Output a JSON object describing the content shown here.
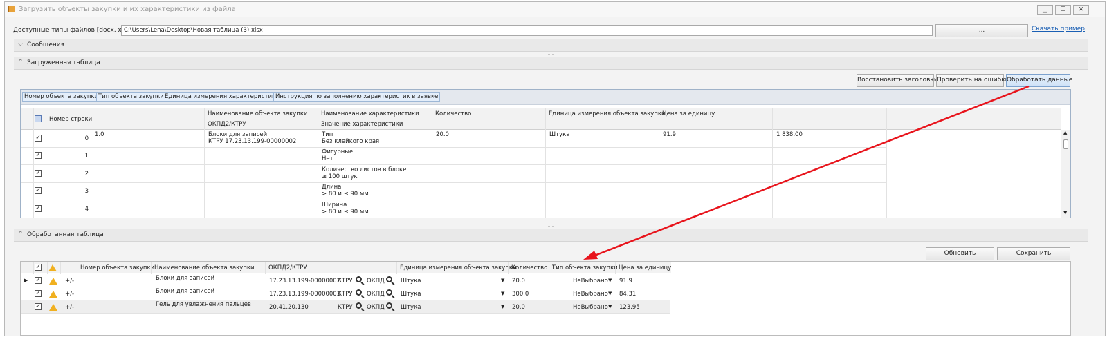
{
  "window": {
    "title": "Загрузить объекты закупки и их характеристики из файла",
    "min": "▁",
    "max": "☐",
    "close": "✕"
  },
  "file": {
    "label": "Доступные типы файлов [docx, xlsx]",
    "path": "C:\\Users\\Lena\\Desktop\\Новая таблица (3).xlsx",
    "browse": "...",
    "sample_link": "Скачать пример"
  },
  "sections": {
    "messages": "Сообщения",
    "loaded": "Загруженная таблица",
    "processed": "Обработанная таблица"
  },
  "loaded_buttons": {
    "restore": "Восстановить заголовки",
    "check": "Проверить на ошибки",
    "process": "Обработать данные"
  },
  "group_chips": [
    "Номер объекта закупки",
    "Тип объекта закупки",
    "Единица измерения характеристики",
    "Инструкция по заполнению характеристик в заявке"
  ],
  "loaded_headers": {
    "row_no": "Номер строки",
    "name1": "Наименование объекта закупки",
    "name2": "ОКПД2/КТРУ",
    "char1": "Наименование характеристики",
    "char2": "Значение характеристики",
    "qty": "Количество",
    "unit": "Единица измерения объекта закупки",
    "price": "Цена за единицу"
  },
  "loaded_rows": [
    {
      "checked": true,
      "row": "0",
      "num": "1.0",
      "name1": "Блоки для записей",
      "name2": "КТРУ 17.23.13.199-00000002",
      "char1": "Тип",
      "char2": "Без клейкого края",
      "qty": "20.0",
      "unit": "Штука",
      "price": "91.9",
      "total": "1 838,00"
    },
    {
      "checked": true,
      "row": "1",
      "num": "",
      "name1": "",
      "name2": "",
      "char1": "Фигурные",
      "char2": "Нет",
      "qty": "",
      "unit": "",
      "price": "",
      "total": ""
    },
    {
      "checked": true,
      "row": "2",
      "num": "",
      "name1": "",
      "name2": "",
      "char1": "Количество листов в блоке",
      "char2": "≥ 100 штук",
      "qty": "",
      "unit": "",
      "price": "",
      "total": ""
    },
    {
      "checked": true,
      "row": "3",
      "num": "",
      "name1": "",
      "name2": "",
      "char1": "Длина",
      "char2": "> 80 и ≤ 90 мм",
      "qty": "",
      "unit": "",
      "price": "",
      "total": ""
    },
    {
      "checked": true,
      "row": "4",
      "num": "",
      "name1": "",
      "name2": "",
      "char1": "Ширина",
      "char2": "> 80 и ≤ 90 мм",
      "qty": "",
      "unit": "",
      "price": "",
      "total": ""
    }
  ],
  "processed_buttons": {
    "refresh": "Обновить",
    "save": "Сохранить"
  },
  "processed_headers": {
    "num": "Номер объекта закупки",
    "name": "Наименование объекта закупки",
    "okpd": "ОКПД2/КТРУ",
    "unit": "Единица измерения объекта закупки",
    "qty": "Количество",
    "type": "Тип объекта закупки",
    "price": "Цена за единицу"
  },
  "processed_rows": [
    {
      "pm": "+/-",
      "name": "Блоки для записей",
      "okpd": "17.23.13.199-00000002",
      "ktru": "КТРУ",
      "okpd_btn": "ОКПД",
      "unit": "Штука",
      "qty": "20.0",
      "type": "НеВыбрано",
      "price": "91.9"
    },
    {
      "pm": "+/-",
      "name": "Блоки для записей",
      "okpd": "17.23.13.199-00000003",
      "ktru": "КТРУ",
      "okpd_btn": "ОКПД",
      "unit": "Штука",
      "qty": "300.0",
      "type": "НеВыбрано",
      "price": "84.31"
    },
    {
      "pm": "+/-",
      "name": "Гель для увлажнения пальцев",
      "okpd": "20.41.20.130",
      "ktru": "КТРУ",
      "okpd_btn": "ОКПД",
      "unit": "Штука",
      "qty": "20.0",
      "type": "НеВыбрано",
      "price": "123.95"
    }
  ],
  "colors": {
    "arrow": "#e8141c",
    "accent": "#1a5fb4"
  }
}
